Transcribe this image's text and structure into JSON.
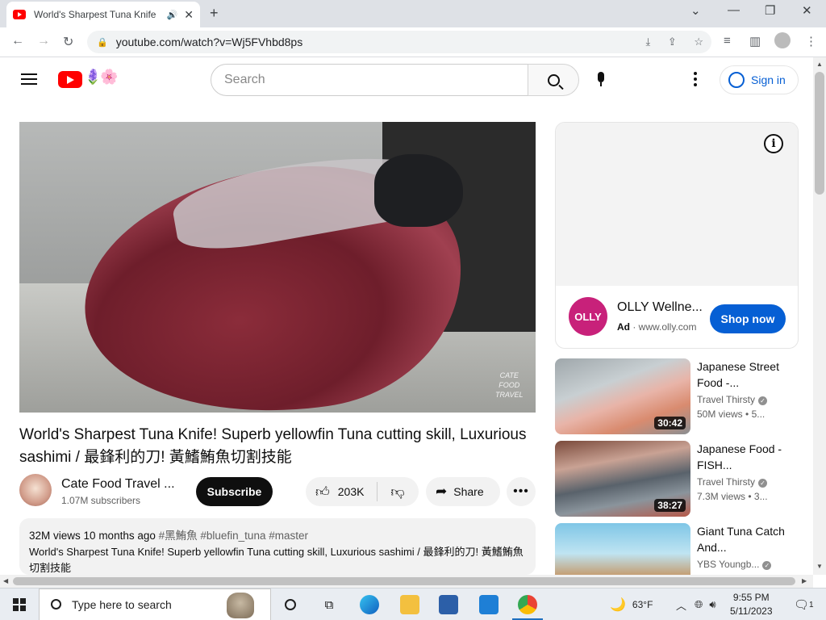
{
  "browser": {
    "tab_title": "World's Sharpest Tuna Knife",
    "url": "youtube.com/watch?v=Wj5FVhbd8ps",
    "new_tab": "+",
    "close": "✕"
  },
  "youtube": {
    "search_placeholder": "Search",
    "sign_in": "Sign in",
    "doodle": "🪻🌸"
  },
  "video": {
    "watermark": [
      "CATE",
      "FOOD",
      "TRAVEL"
    ],
    "title": "World's Sharpest Tuna Knife!  Superb yellowfin Tuna cutting skill, Luxurious sashimi / 最鋒利的刀!  黃鰭鮪魚切割技能",
    "channel_name": "Cate Food Travel ...",
    "channel_subs": "1.07M subscribers",
    "subscribe": "Subscribe",
    "likes": "203K",
    "share": "Share",
    "more": "•••",
    "views": "32M views",
    "age": "10 months ago",
    "tags": "#黑鮪魚 #bluefin_tuna #master",
    "description": "World's Sharpest Tuna Knife!  Superb yellowfin Tuna cutting skill, Luxurious sashimi / 最鋒利的刀!  黃鰭鮪魚切割技能"
  },
  "ad": {
    "logo": "OLLY",
    "title": "OLLY Wellne...",
    "label": "Ad",
    "domain": "www.olly.com",
    "cta": "Shop now",
    "info": "i"
  },
  "recommendations": [
    {
      "title": "Japanese Street Food -...",
      "channel": "Travel Thirsty",
      "views": "50M views",
      "age": "• 5...",
      "duration": "30:42"
    },
    {
      "title": "Japanese Food - FISH...",
      "channel": "Travel Thirsty",
      "views": "7.3M views",
      "age": "• 3...",
      "duration": "38:27"
    },
    {
      "title": "Giant Tuna Catch And...",
      "channel": "YBS Youngb...",
      "views": "",
      "age": "",
      "duration": ""
    }
  ],
  "taskbar": {
    "search_placeholder": "Type here to search",
    "weather": "63°F",
    "time": "9:55 PM",
    "date": "5/11/2023",
    "notifications": "1"
  }
}
